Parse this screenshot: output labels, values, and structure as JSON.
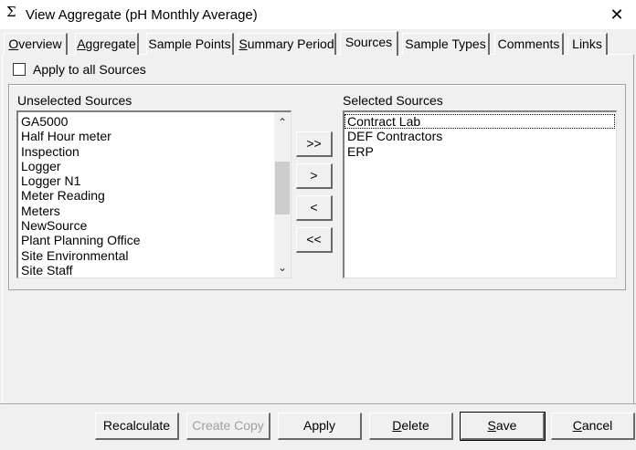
{
  "window": {
    "icon": "sigma-icon",
    "title": "View Aggregate (pH Monthly Average)",
    "close_glyph": "✕"
  },
  "tabs": [
    {
      "prefix": "",
      "mnemonic": "O",
      "rest": "verview",
      "active": false
    },
    {
      "prefix": "",
      "mnemonic": "A",
      "rest": "ggregate",
      "active": false
    },
    {
      "prefix": "Sample Points",
      "mnemonic": "",
      "rest": "",
      "active": false
    },
    {
      "prefix": "",
      "mnemonic": "S",
      "rest": "ummary Period",
      "active": false
    },
    {
      "prefix": "Sources",
      "mnemonic": "",
      "rest": "",
      "active": true
    },
    {
      "prefix": "Sample Types",
      "mnemonic": "",
      "rest": "",
      "active": false
    },
    {
      "prefix": "Comments",
      "mnemonic": "",
      "rest": "",
      "active": false
    },
    {
      "prefix": "Links",
      "mnemonic": "",
      "rest": "",
      "active": false
    }
  ],
  "apply_all": {
    "label": "Apply to all Sources",
    "checked": false
  },
  "unselected": {
    "label": "Unselected Sources",
    "items": [
      "GA5000",
      "Half Hour meter",
      "Inspection",
      "Logger",
      "Logger N1",
      "Meter Reading",
      "Meters",
      "NewSource",
      "Plant Planning Office",
      "Site Environmental",
      "Site Staff"
    ]
  },
  "selected": {
    "label": "Selected Sources",
    "items": [
      "Contract Lab",
      "DEF Contractors",
      "ERP"
    ]
  },
  "move_buttons": {
    "add_all": ">>",
    "add": ">",
    "remove": "<",
    "remove_all": "<<"
  },
  "scroll": {
    "up_glyph": "⌃",
    "down_glyph": "⌄"
  },
  "buttons": {
    "recalculate": "Recalculate",
    "create_copy": "Create Copy",
    "apply": "Apply",
    "delete_prefix": "",
    "delete_mnemonic": "D",
    "delete_rest": "elete",
    "save_mnemonic": "S",
    "save_rest": "ave",
    "cancel_mnemonic": "C",
    "cancel_rest": "ancel"
  }
}
